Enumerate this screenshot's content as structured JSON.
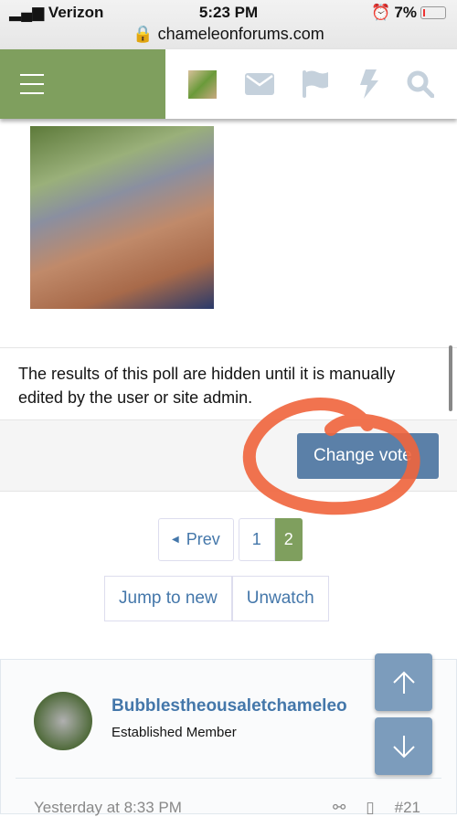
{
  "status_bar": {
    "carrier": "Verizon",
    "time": "5:23 PM",
    "battery": "7%",
    "url": "chameleonforums.com"
  },
  "nav": {
    "icons": [
      "menu-icon",
      "user-avatar",
      "envelope-icon",
      "flag-icon",
      "bolt-icon",
      "search-icon"
    ],
    "accent": "#7f9f5e"
  },
  "poll": {
    "message": "The results of this poll are hidden until it is manually edited by the user or site admin.",
    "change_vote": "Change vote"
  },
  "pagination": {
    "prev": "Prev",
    "pages": [
      "1",
      "2"
    ],
    "current": "2"
  },
  "thread_actions": {
    "jump": "Jump to new",
    "unwatch": "Unwatch"
  },
  "post": {
    "username": "Bubblestheousaletchameleo",
    "user_title": "Established Member",
    "date": "Yesterday at 8:33 PM",
    "number": "#21"
  },
  "annotation_color": "#f0643c"
}
